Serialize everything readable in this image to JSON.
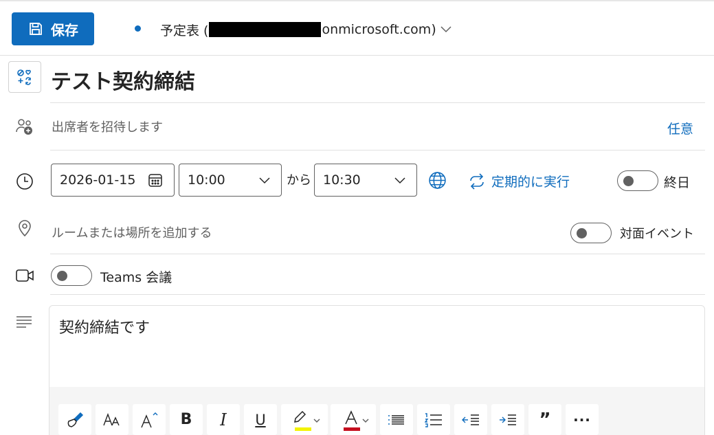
{
  "header": {
    "save_label": "保存",
    "calendar_prefix": "予定表 (",
    "calendar_suffix": "onmicrosoft.com)"
  },
  "event": {
    "title": "テスト契約締結",
    "attendees_placeholder": "出席者を招待します",
    "optional_label": "任意",
    "date": "2026-01-15",
    "start_time": "10:00",
    "to_label": "から",
    "end_time": "10:30",
    "recurrence_label": "定期的に実行",
    "all_day_label": "終日",
    "all_day_on": false,
    "location_placeholder": "ルームまたは場所を追加する",
    "in_person_label": "対面イベント",
    "in_person_on": false,
    "teams_label": "Teams 会議",
    "teams_on": false,
    "body": "契約締結です"
  },
  "colors": {
    "accent": "#0f6cbd",
    "highlight": "#f3f300",
    "font_color": "#c50f1f"
  },
  "toolbar": {
    "buttons": [
      "format-painter-icon",
      "font-size-icon",
      "grow-font-icon",
      "bold-icon",
      "italic-icon",
      "underline-icon",
      "highlight-icon",
      "font-color-icon",
      "bullets-icon",
      "numbering-icon",
      "decrease-indent-icon",
      "increase-indent-icon",
      "quote-icon",
      "more-icon"
    ],
    "bold_glyph": "B",
    "italic_glyph": "I",
    "underline_glyph": "U",
    "quote_glyph": "”",
    "more_glyph": "···"
  }
}
